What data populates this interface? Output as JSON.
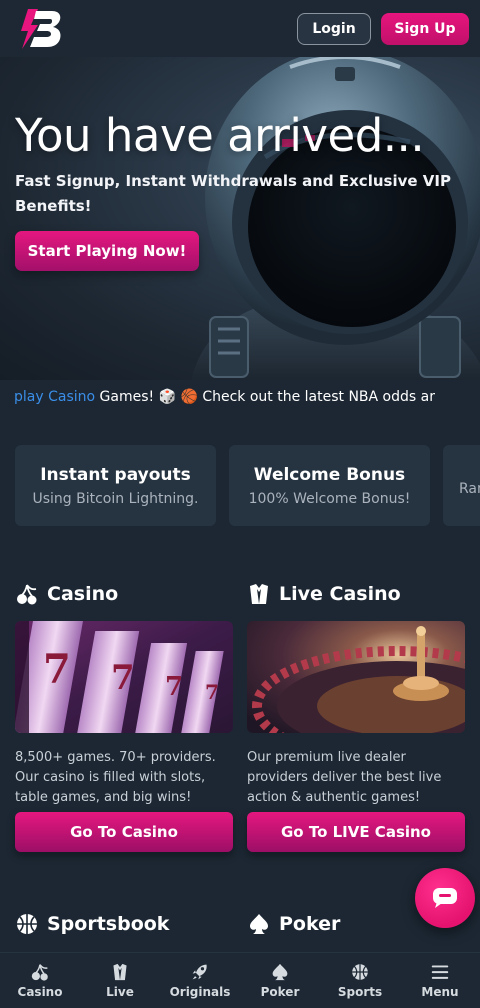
{
  "header": {
    "logo_label": "B",
    "login_label": "Login",
    "signup_label": "Sign Up"
  },
  "hero": {
    "title": "You have arrived...",
    "subtitle": "Fast Signup, Instant Withdrawals and Exclusive VIP Benefits!",
    "cta_label": "Start Playing Now!"
  },
  "ticker": {
    "link_text": "play Casino",
    "text": " Games! 🎲  🏀 Check out the latest NBA odds ar"
  },
  "features": [
    {
      "title": "Instant payouts",
      "desc": "Using Bitcoin Lightning."
    },
    {
      "title": "Welcome Bonus",
      "desc": "100% Welcome Bonus!"
    },
    {
      "title": "",
      "desc": "Ran"
    }
  ],
  "products": {
    "casino": {
      "title": "Casino",
      "desc": "8,500+ games. 70+ providers. Our casino is filled with slots, table games, and big wins!",
      "button": "Go To Casino",
      "icon": "cherry-icon"
    },
    "live": {
      "title": "Live Casino",
      "desc": "Our premium live dealer providers deliver the best live action & authentic games!",
      "button": "Go To LIVE Casino",
      "icon": "dealer-icon"
    },
    "sportsbook": {
      "title": "Sportsbook",
      "icon": "basketball-icon"
    },
    "poker": {
      "title": "Poker",
      "icon": "spade-icon"
    }
  },
  "nav": [
    {
      "label": "Casino",
      "icon": "cherry-icon"
    },
    {
      "label": "Live",
      "icon": "dealer-icon"
    },
    {
      "label": "Originals",
      "icon": "rocket-icon"
    },
    {
      "label": "Poker",
      "icon": "spade-icon"
    },
    {
      "label": "Sports",
      "icon": "basketball-icon"
    },
    {
      "label": "Menu",
      "icon": "hamburger-icon"
    }
  ],
  "colors": {
    "background": "#1c2733",
    "accent": "#e5177f",
    "card": "#263441",
    "link": "#3a8ee8"
  }
}
